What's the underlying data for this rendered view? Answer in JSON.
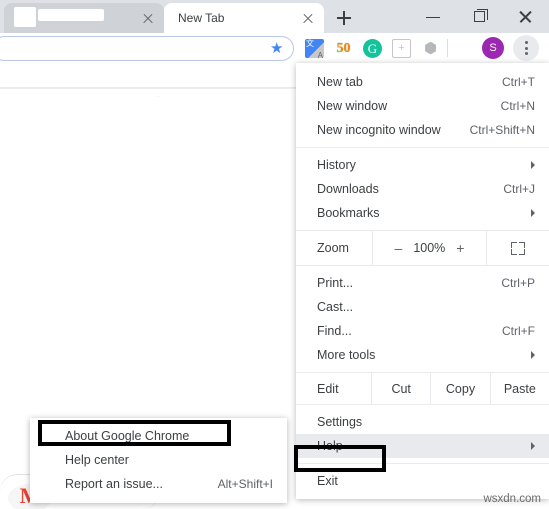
{
  "window": {
    "tabs": [
      {
        "title": "",
        "redacted": true,
        "active": false,
        "close_icon": "close-icon"
      },
      {
        "title": "New Tab",
        "redacted": false,
        "active": true,
        "close_icon": "close-icon"
      }
    ],
    "new_tab_button": "+",
    "controls": {
      "minimize": "–",
      "maximize": "☐",
      "close": "✕"
    }
  },
  "toolbar": {
    "omnibox_value": "",
    "omnibox_placeholder": "",
    "bookmark_star": "★",
    "extensions": [
      {
        "name": "google-translate-extension",
        "glyph": "文"
      },
      {
        "name": "sq-extension",
        "glyph": "50"
      },
      {
        "name": "grammarly-extension",
        "glyph": "G"
      },
      {
        "name": "document-extension",
        "glyph": "+"
      },
      {
        "name": "cube-extension",
        "glyph": "⬢"
      }
    ],
    "avatar_initial": "S",
    "menu_button": "kebab-menu"
  },
  "menu": {
    "groups": [
      {
        "items": [
          {
            "label": "New tab",
            "accel": "Ctrl+T",
            "submenu": false
          },
          {
            "label": "New window",
            "accel": "Ctrl+N",
            "submenu": false
          },
          {
            "label": "New incognito window",
            "accel": "Ctrl+Shift+N",
            "submenu": false
          }
        ]
      },
      {
        "items": [
          {
            "label": "History",
            "accel": "",
            "submenu": true
          },
          {
            "label": "Downloads",
            "accel": "Ctrl+J",
            "submenu": false
          },
          {
            "label": "Bookmarks",
            "accel": "",
            "submenu": true
          }
        ]
      },
      {
        "items": [
          {
            "label": "Print...",
            "accel": "Ctrl+P",
            "submenu": false
          },
          {
            "label": "Cast...",
            "accel": "",
            "submenu": false
          },
          {
            "label": "Find...",
            "accel": "Ctrl+F",
            "submenu": false
          },
          {
            "label": "More tools",
            "accel": "",
            "submenu": true
          }
        ]
      },
      {
        "items": [
          {
            "label": "Settings",
            "accel": "",
            "submenu": false
          },
          {
            "label": "Help",
            "accel": "",
            "submenu": true,
            "highlighted": true
          },
          {
            "label": "Exit",
            "accel": "",
            "submenu": false
          }
        ]
      }
    ],
    "zoom_row": {
      "label": "Zoom",
      "minus": "–",
      "level": "100%",
      "plus": "+",
      "fullscreen_icon": "fullscreen-icon"
    },
    "edit_row": {
      "label": "Edit",
      "cut": "Cut",
      "copy": "Copy",
      "paste": "Paste"
    }
  },
  "help_submenu": {
    "items": [
      {
        "label": "About Google Chrome",
        "accel": "",
        "highlighted": true
      },
      {
        "label": "Help center",
        "accel": ""
      },
      {
        "label": "Report an issue...",
        "accel": "Alt+Shift+I"
      }
    ]
  },
  "page": {
    "gmail_logo": "M"
  },
  "watermark": "wsxdn.com",
  "colors": {
    "tabstrip_bg": "#dee1e6",
    "inactive_tab": "#cfd3d8",
    "accent_blue": "#4285f4",
    "avatar_purple": "#9c27b0",
    "menu_highlight": "#e8eaed",
    "annotation": "#000000",
    "gmail_red": "#ea4335"
  }
}
